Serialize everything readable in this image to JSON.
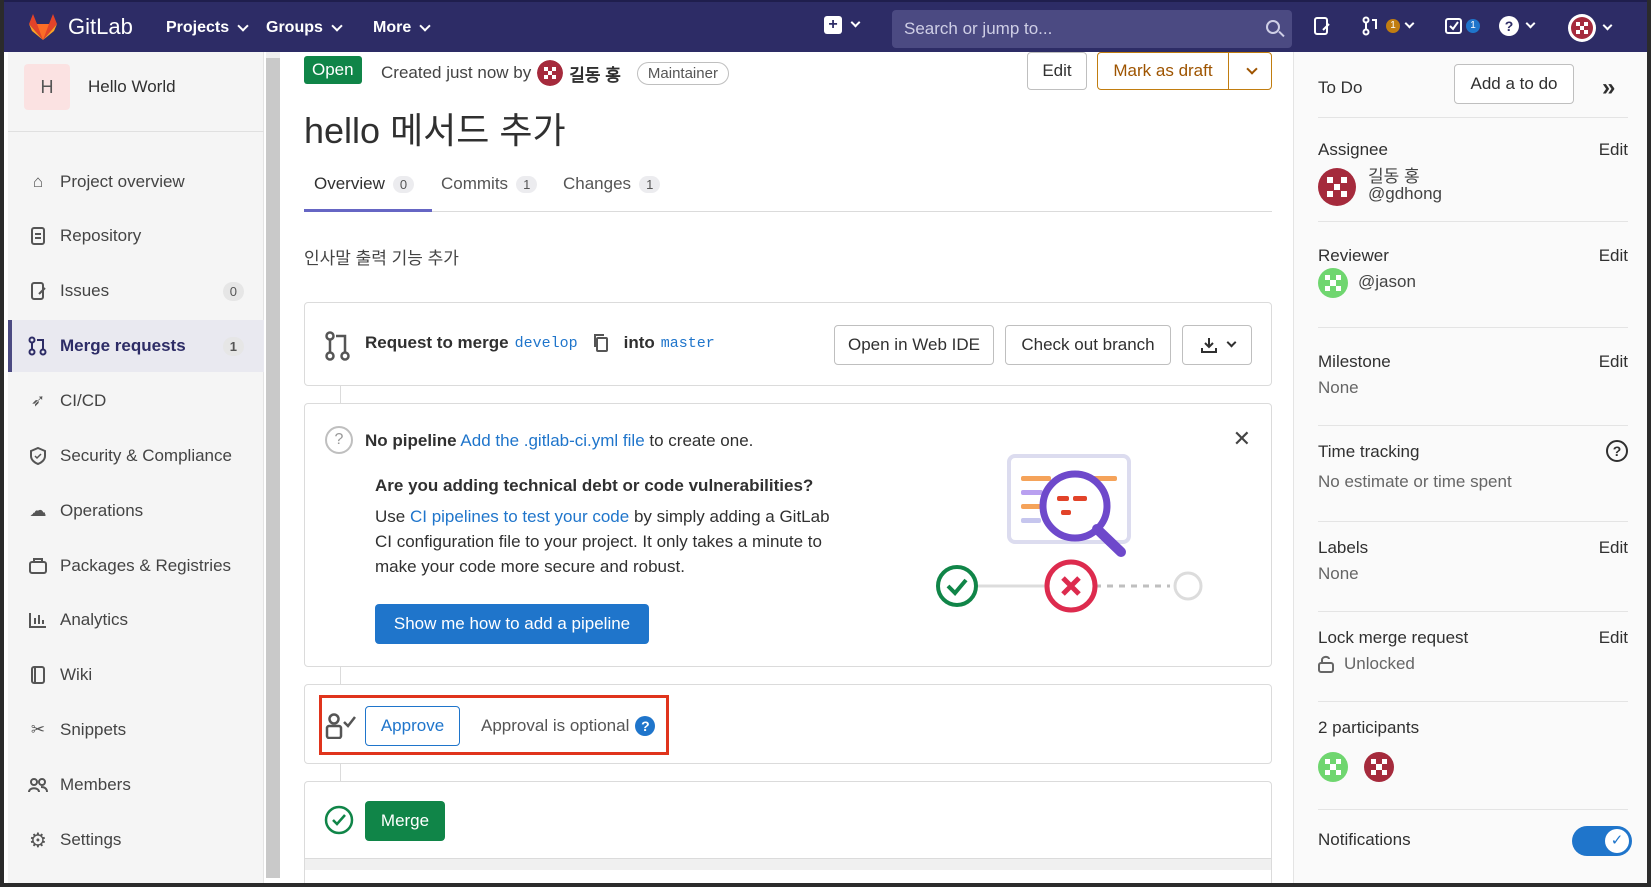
{
  "topnav": {
    "brand": "GitLab",
    "projects": "Projects",
    "groups": "Groups",
    "more": "More",
    "search_placeholder": "Search or jump to...",
    "mr_badge": "1",
    "todo_badge": "1"
  },
  "sidebar": {
    "project_initial": "H",
    "project_name": "Hello World",
    "items": [
      {
        "label": "Project overview",
        "icon": "home-icon"
      },
      {
        "label": "Repository",
        "icon": "doc-icon"
      },
      {
        "label": "Issues",
        "icon": "issues-icon",
        "count": "0"
      },
      {
        "label": "Merge requests",
        "icon": "merge-request-icon",
        "count": "1"
      },
      {
        "label": "CI/CD",
        "icon": "rocket-icon"
      },
      {
        "label": "Security & Compliance",
        "icon": "shield-icon"
      },
      {
        "label": "Operations",
        "icon": "cloud-icon"
      },
      {
        "label": "Packages & Registries",
        "icon": "package-icon"
      },
      {
        "label": "Analytics",
        "icon": "chart-icon"
      },
      {
        "label": "Wiki",
        "icon": "book-icon"
      },
      {
        "label": "Snippets",
        "icon": "scissors-icon"
      },
      {
        "label": "Members",
        "icon": "users-icon"
      },
      {
        "label": "Settings",
        "icon": "gear-icon"
      }
    ]
  },
  "header": {
    "status": "Open",
    "created_prefix": "Created just now by",
    "author": "길동 홍",
    "role": "Maintainer",
    "edit": "Edit",
    "mark_draft": "Mark as draft",
    "title": "hello 메서드 추가"
  },
  "tabs": [
    {
      "label": "Overview",
      "count": "0"
    },
    {
      "label": "Commits",
      "count": "1"
    },
    {
      "label": "Changes",
      "count": "1"
    }
  ],
  "description": "인사말 출력 기능 추가",
  "merge_info": {
    "prefix": "Request to merge",
    "source": "develop",
    "into": "into",
    "target": "master",
    "open_ide": "Open in Web IDE",
    "checkout": "Check out branch"
  },
  "pipeline": {
    "no_pipeline": "No pipeline",
    "add_link": "Add the .gitlab-ci.yml file",
    "to_create": "to create one.",
    "heading": "Are you adding technical debt or code vulnerabilities?",
    "body_use": "Use",
    "body_link": "CI pipelines to test your code",
    "body_rest1": "by simply adding a GitLab",
    "body_rest2": "CI configuration file to your project. It only takes a minute to",
    "body_rest3": "make your code more secure and robust.",
    "cta": "Show me how to add a pipeline"
  },
  "approval": {
    "button": "Approve",
    "text": "Approval is optional"
  },
  "merge": {
    "button": "Merge"
  },
  "right": {
    "todo_label": "To Do",
    "add_todo": "Add a to do",
    "assignee_label": "Assignee",
    "assignee_name": "길동 홍",
    "assignee_handle": "@gdhong",
    "reviewer_label": "Reviewer",
    "reviewer_handle": "@jason",
    "milestone_label": "Milestone",
    "milestone_value": "None",
    "time_label": "Time tracking",
    "time_value": "No estimate or time spent",
    "labels_label": "Labels",
    "labels_value": "None",
    "lock_label": "Lock merge request",
    "lock_value": "Unlocked",
    "participants": "2 participants",
    "notifications": "Notifications",
    "edit": "Edit"
  },
  "colors": {
    "nav": "#2d2c66",
    "primary": "#1f75cb",
    "success": "#108548",
    "highlight": "#e0341c"
  }
}
